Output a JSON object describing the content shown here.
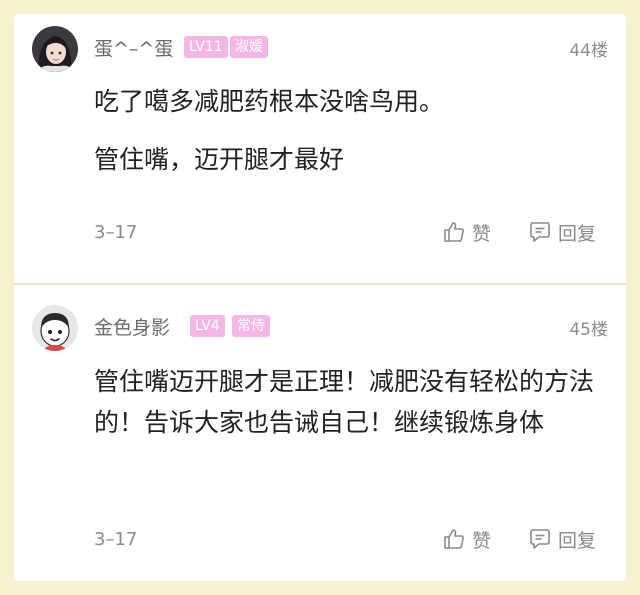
{
  "comments": [
    {
      "username": "蛋^–^蛋",
      "level_badge": "LV11",
      "title_badge": "淑媛",
      "floor": "44楼",
      "paragraphs": [
        "吃了噶多减肥药根本没啥鸟用。",
        "管住嘴，迈开腿才最好"
      ],
      "date": "3–17",
      "like_label": "赞",
      "reply_label": "回复",
      "avatar_icon": "girl-portrait-avatar"
    },
    {
      "username": "金色身影",
      "level_badge": "LV4",
      "title_badge": "常侍",
      "floor": "45楼",
      "paragraphs": [
        "管住嘴迈开腿才是正理！减肥没有轻松的方法的！告诉大家也告诫自己！继续锻炼身体"
      ],
      "date": "3–17",
      "like_label": "赞",
      "reply_label": "回复",
      "avatar_icon": "cartoon-face-avatar"
    }
  ],
  "colors": {
    "page_background": "#f6f1cf",
    "card_background": "#ffffff",
    "badge_pink": "#f4b6e4",
    "username_gray": "#6b6b6b",
    "meta_gray": "#8a8a8a",
    "content_text": "#222222"
  }
}
